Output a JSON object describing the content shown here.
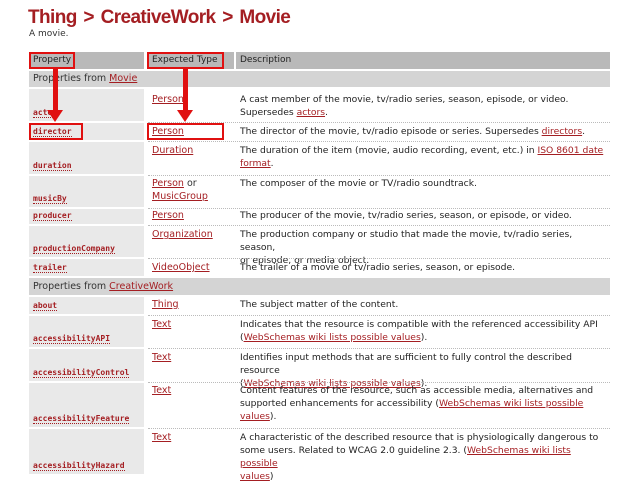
{
  "breadcrumb": {
    "thing": "Thing",
    "sep1": ">",
    "creativework": "CreativeWork",
    "sep2": ">",
    "movie": "Movie"
  },
  "subtitle": "A movie.",
  "table_header": {
    "property": "Property",
    "expected_type": "Expected Type",
    "description": "Description"
  },
  "section_movie": {
    "prefix": "Properties from ",
    "link": "Movie"
  },
  "section_creativework": {
    "prefix": "Properties from ",
    "link": "CreativeWork"
  },
  "rows": [
    {
      "name": "actor",
      "type": "Person",
      "desc1": "A cast member of the movie, tv/radio series, season, episode, or video.",
      "desc2a": "Supersedes ",
      "desc2link": "actors",
      "desc2b": "."
    },
    {
      "name": "director",
      "type": "Person",
      "desc1a": "The director of the movie, tv/radio episode or series. Supersedes ",
      "desc1link": "directors",
      "desc1b": "."
    },
    {
      "name": "duration",
      "type": "Duration",
      "desc1a": "The duration of the item (movie, audio recording, event, etc.) in ",
      "desc1link": "ISO 8601 date",
      "desc2link": "format",
      "desc2b": "."
    },
    {
      "name": "musicBy",
      "type": "Person",
      "type_or": " or",
      "type2": "MusicGroup",
      "desc1": "The composer of the movie or TV/radio soundtrack."
    },
    {
      "name": "producer",
      "type": "Person",
      "desc1": "The producer of the movie, tv/radio series, season, or episode, or video."
    },
    {
      "name": "productionCompany",
      "type": "Organization",
      "desc1": "The production company or studio that made the movie, tv/radio series, season,",
      "desc2": "or episode, or media object."
    },
    {
      "name": "trailer",
      "type": "VideoObject",
      "desc1": "The trailer of a movie or tv/radio series, season, or episode."
    },
    {
      "name": "about",
      "type": "Thing",
      "desc1": "The subject matter of the content."
    },
    {
      "name": "accessibilityAPI",
      "type": "Text",
      "desc1": "Indicates that the resource is compatible with the referenced accessibility API",
      "desc2a": "(",
      "desc2link": "WebSchemas wiki lists possible values",
      "desc2b": ")."
    },
    {
      "name": "accessibilityControl",
      "type": "Text",
      "desc1": "Identifies input methods that are sufficient to fully control the described resource",
      "desc2a": "(",
      "desc2link": "WebSchemas wiki lists possible values",
      "desc2b": ")."
    },
    {
      "name": "accessibilityFeature",
      "type": "Text",
      "desc1": "Content features of the resource, such as accessible media, alternatives and",
      "desc2a": "supported enhancements for accessibility (",
      "desc2link": "WebSchemas wiki lists possible",
      "desc3link": "values",
      "desc3b": ")."
    },
    {
      "name": "accessibilityHazard",
      "type": "Text",
      "desc1": "A characteristic of the described resource that is physiologically dangerous to",
      "desc2a": "some users. Related to WCAG 2.0 guideline 2.3. (",
      "desc2link": "WebSchemas wiki lists possible",
      "desc3link": "values",
      "desc3b": ")"
    }
  ],
  "colors": {
    "brand_red": "#a41e22",
    "annotation_red": "#e01010",
    "header_gray": "#b9b9b9"
  },
  "annotations": [
    "red-box-property-header",
    "red-box-expected-type-header",
    "red-box-director",
    "red-box-person",
    "arrow-property-to-director",
    "arrow-type-to-person"
  ]
}
